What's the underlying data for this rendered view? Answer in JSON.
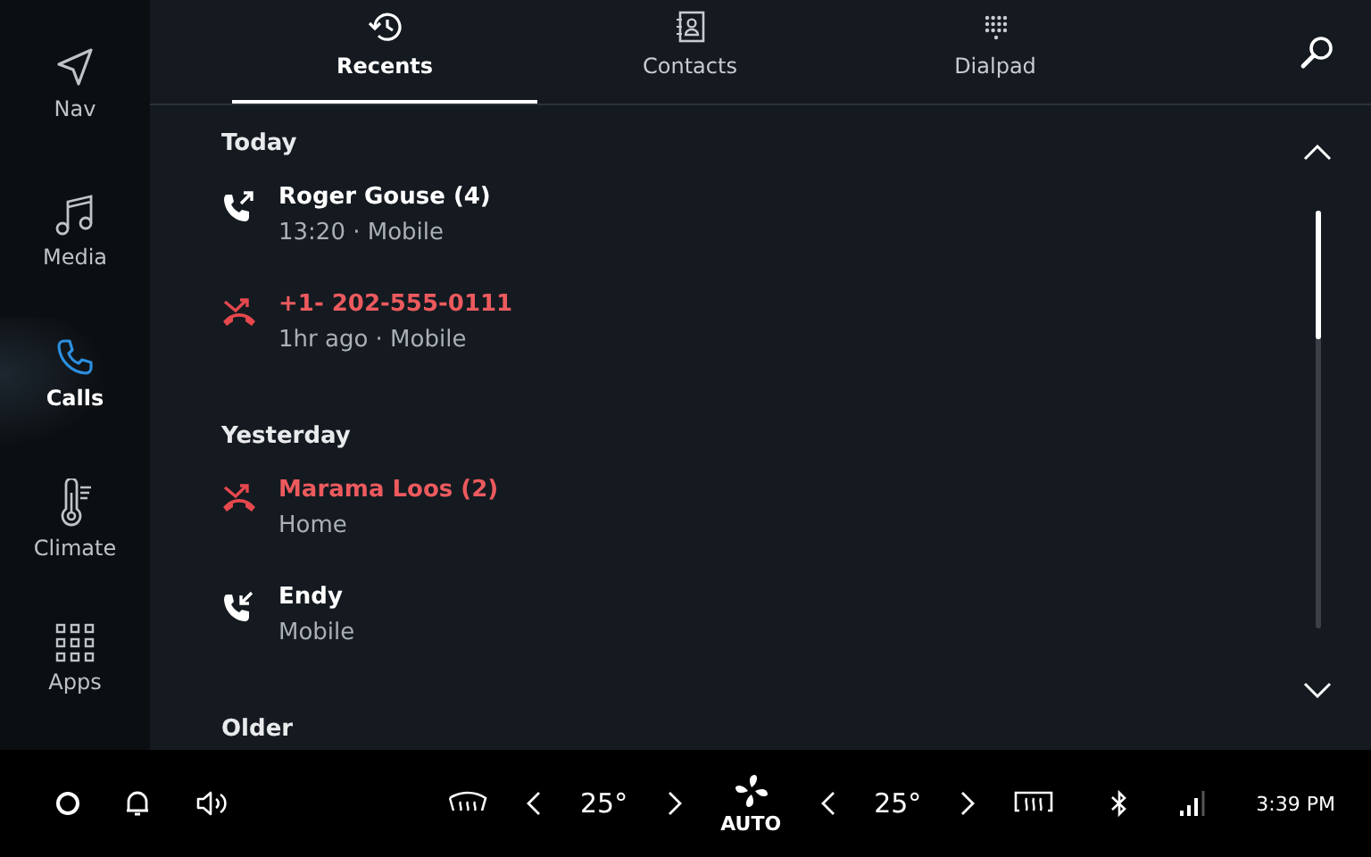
{
  "sidebar": {
    "items": [
      {
        "label": "Nav",
        "kind": "nav",
        "selected": false
      },
      {
        "label": "Media",
        "kind": "media",
        "selected": false
      },
      {
        "label": "Calls",
        "kind": "calls",
        "selected": true
      },
      {
        "label": "Climate",
        "kind": "climate",
        "selected": false
      },
      {
        "label": "Apps",
        "kind": "apps",
        "selected": false
      }
    ]
  },
  "tabs": [
    {
      "label": "Recents",
      "kind": "history",
      "selected": true
    },
    {
      "label": "Contacts",
      "kind": "contacts",
      "selected": false
    },
    {
      "label": "Dialpad",
      "kind": "dialpad",
      "selected": false
    }
  ],
  "sections": [
    {
      "title": "Today",
      "calls": [
        {
          "kind": "outgoing",
          "name": "Roger Gouse (4)",
          "detail": "13:20 · Mobile"
        },
        {
          "kind": "missed",
          "name": "+1- 202-555-0111",
          "detail": "1hr ago · Mobile"
        }
      ]
    },
    {
      "title": "Yesterday",
      "calls": [
        {
          "kind": "missed",
          "name": "Marama Loos (2)",
          "detail": "Home"
        },
        {
          "kind": "incoming",
          "name": "Endy",
          "detail": "Mobile"
        }
      ]
    },
    {
      "title": "Older"
    }
  ],
  "bottom_bar": {
    "left_temp": "25°",
    "fan_mode": "AUTO",
    "right_temp": "25°",
    "time": "3:39 PM"
  }
}
